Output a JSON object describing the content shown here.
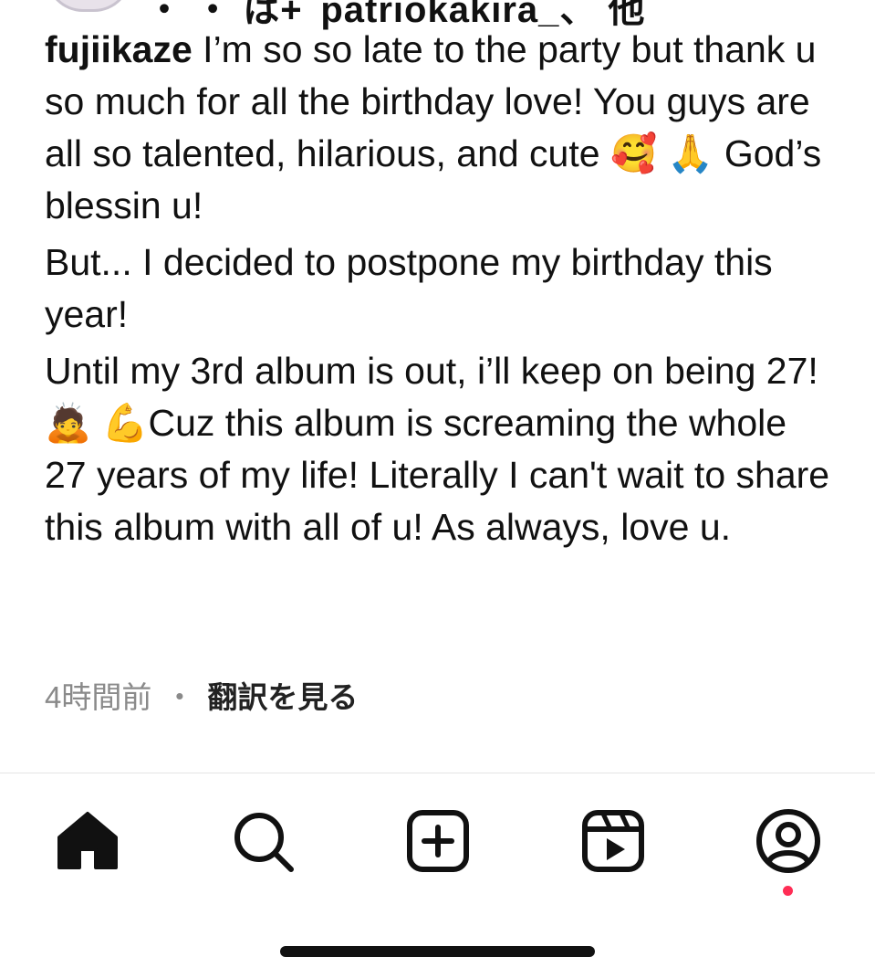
{
  "post": {
    "top_cut_text": "・ ・ は+  patriokakira_、 他",
    "username": "fujiikaze",
    "paragraphs": [
      " I’m so so late to the party but thank u so much for all the birthday love! You guys are all so talented, hilarious, and cute 🥰 🙏 God’s blessin u!",
      "But... I decided to postpone my birthday this year!",
      "Until my 3rd album is out, i’ll keep on being 27! 🙇 💪Cuz this album is screaming the whole 27 years of my life! Literally I can't wait to share this album with all of u! As always, love u."
    ],
    "time": "4時間前",
    "separator": "・",
    "translate_label": "翻訳を見る"
  },
  "tabbar": {
    "icons": [
      "home-icon",
      "search-icon",
      "create-icon",
      "reels-icon",
      "profile-icon"
    ],
    "notification_color": "#ff2d55"
  },
  "colors": {
    "text": "#111111",
    "muted": "#8a8a8a",
    "divider": "#e5e5e5"
  }
}
